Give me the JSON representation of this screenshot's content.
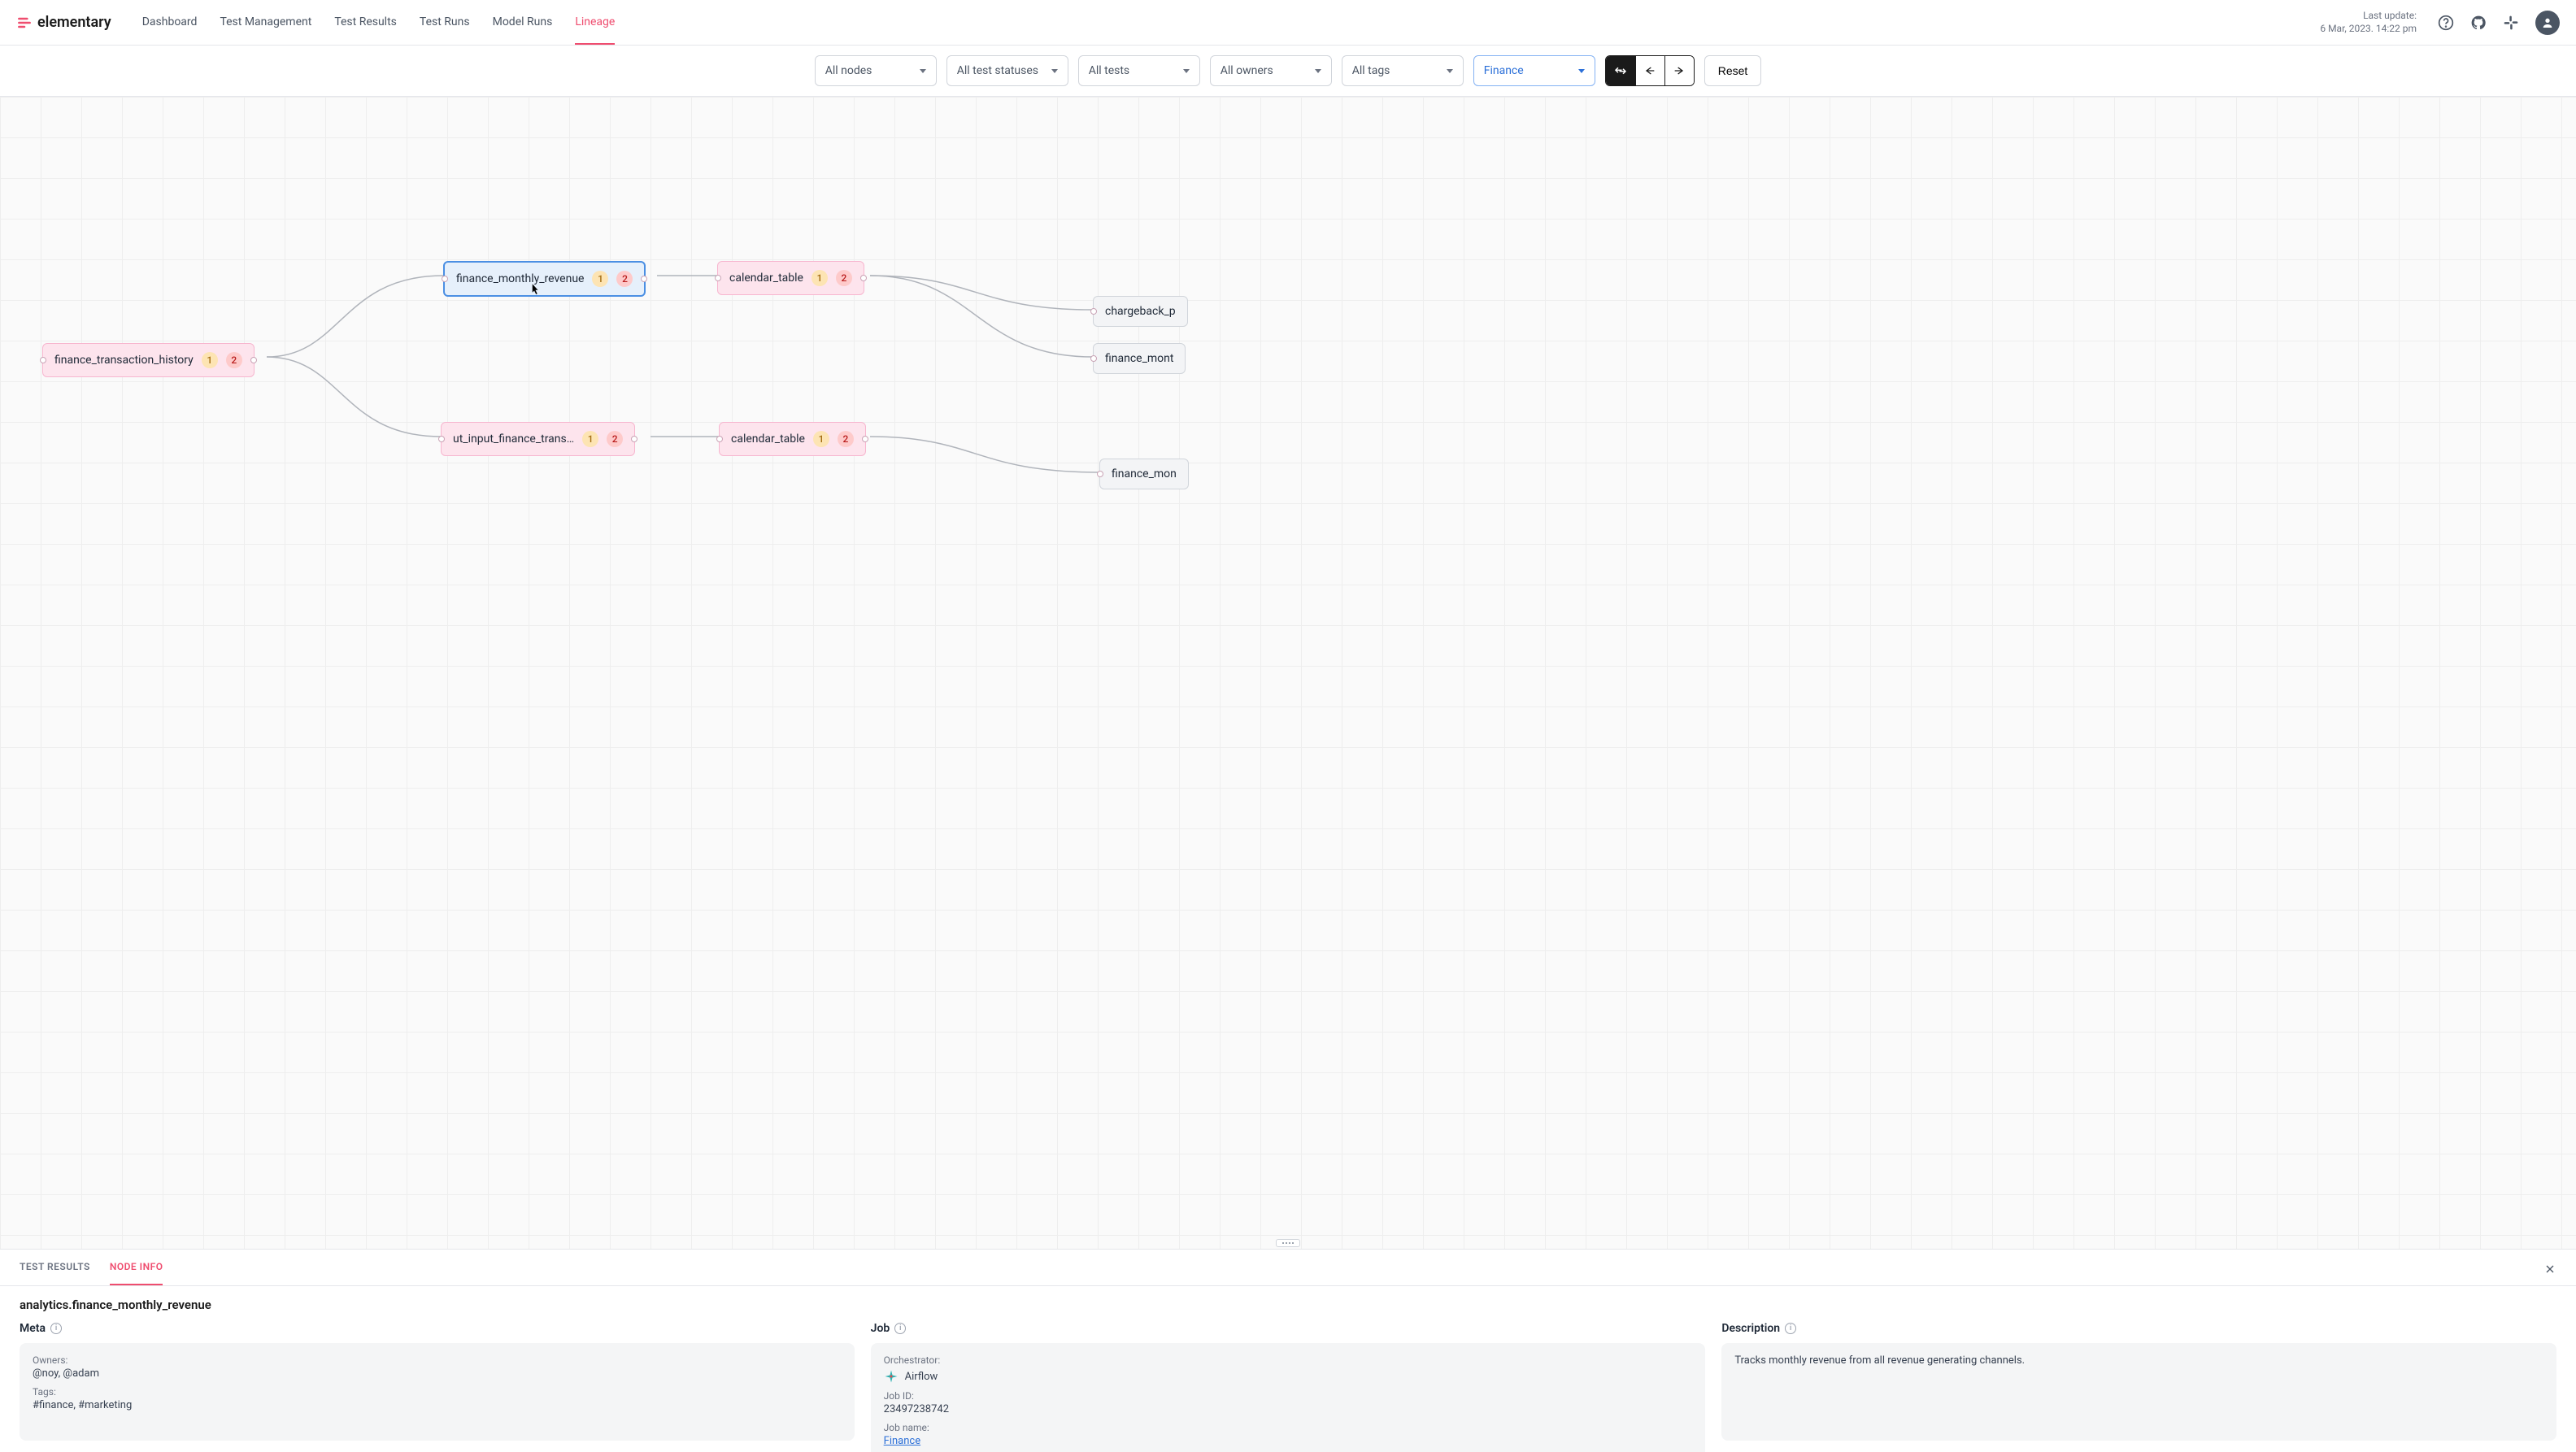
{
  "header": {
    "brand": "elementary",
    "nav": {
      "dashboard": "Dashboard",
      "test_management": "Test Management",
      "test_results": "Test Results",
      "test_runs": "Test Runs",
      "model_runs": "Model Runs",
      "lineage": "Lineage"
    },
    "last_update_label": "Last update:",
    "last_update_value": "6 Mar, 2023. 14:22 pm"
  },
  "filters": {
    "nodes": "All nodes",
    "statuses": "All test statuses",
    "tests": "All tests",
    "owners": "All owners",
    "tags": "All tags",
    "selected": "Finance",
    "reset": "Reset"
  },
  "lineage": {
    "nodes": {
      "fth": {
        "label": "finance_transaction_history",
        "b1": "1",
        "b2": "2"
      },
      "fmr": {
        "label": "finance_monthly_revenue",
        "b1": "1",
        "b2": "2"
      },
      "uift": {
        "label": "ut_input_finance_trans…",
        "b1": "1",
        "b2": "2"
      },
      "cal1": {
        "label": "calendar_table",
        "b1": "1",
        "b2": "2"
      },
      "cal2": {
        "label": "calendar_table",
        "b1": "1",
        "b2": "2"
      },
      "cb": {
        "label": "chargeback_p"
      },
      "fm2": {
        "label": "finance_mont"
      },
      "fm3": {
        "label": "finance_mon"
      }
    }
  },
  "panel": {
    "tabs": {
      "test_results": "TEST RESULTS",
      "node_info": "NODE INFO"
    },
    "node_title": "analytics.finance_monthly_revenue",
    "meta": {
      "header": "Meta",
      "owners_label": "Owners:",
      "owners_value": "@noy, @adam",
      "tags_label": "Tags:",
      "tags_value": "#finance, #marketing"
    },
    "job": {
      "header": "Job",
      "orch_label": "Orchestrator:",
      "orch_value": "Airflow",
      "jobid_label": "Job ID:",
      "jobid_value": "23497238742",
      "jobname_label": "Job name:",
      "jobname_value": "Finance"
    },
    "desc": {
      "header": "Description",
      "value": "Tracks monthly revenue from all revenue generating channels."
    }
  }
}
